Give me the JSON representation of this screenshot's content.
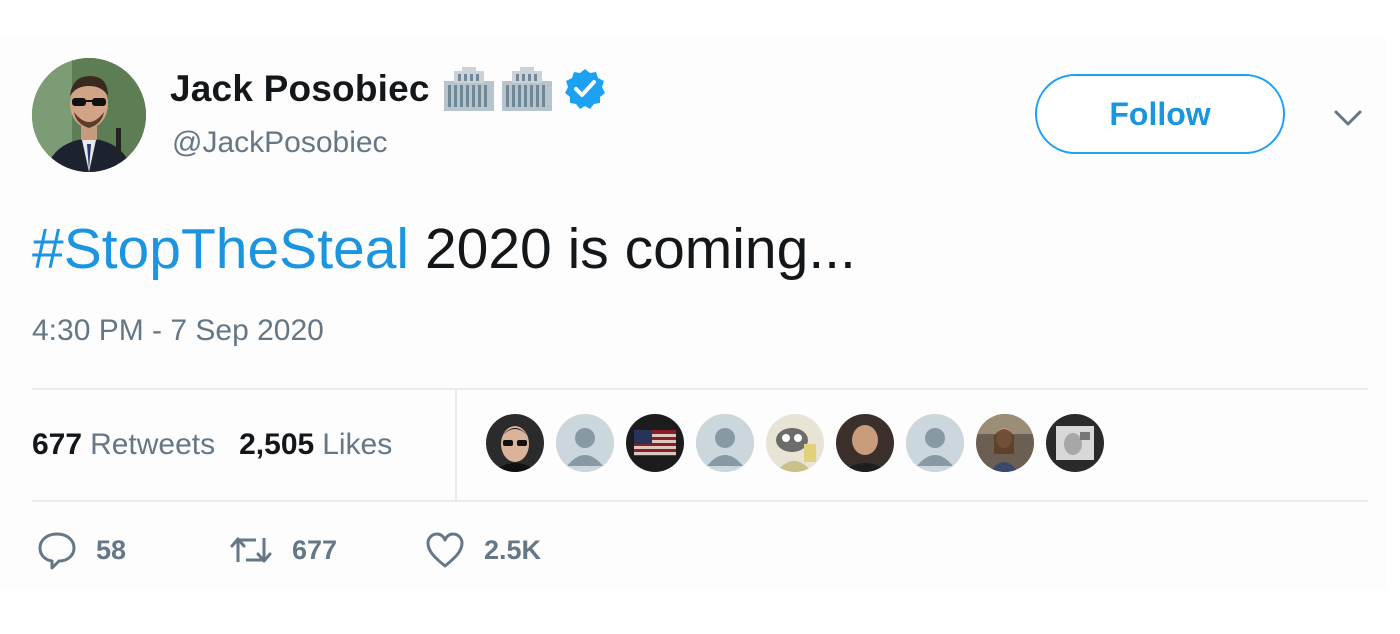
{
  "author": {
    "name": "Jack Posobiec",
    "handle": "@JackPosobiec",
    "name_emojis": [
      "hotel-building-icon",
      "hotel-building-icon"
    ],
    "verified": true
  },
  "follow_button": {
    "label": "Follow"
  },
  "tweet": {
    "hashtag": "#StopTheSteal",
    "text": " 2020 is coming...",
    "timestamp": "4:30 PM - 7 Sep 2020"
  },
  "stats": {
    "retweets_count": "677",
    "retweets_label": "Retweets",
    "likes_count": "2,505",
    "likes_label": "Likes"
  },
  "likers": [
    {
      "icon": "liker-avatar-sunglasses"
    },
    {
      "icon": "default-profile-icon"
    },
    {
      "icon": "liker-avatar-flag"
    },
    {
      "icon": "default-profile-icon"
    },
    {
      "icon": "liker-avatar-cartoon"
    },
    {
      "icon": "liker-avatar-man"
    },
    {
      "icon": "default-profile-icon"
    },
    {
      "icon": "liker-avatar-woman"
    },
    {
      "icon": "liker-avatar-photo"
    }
  ],
  "actions": {
    "replies": "58",
    "retweets": "677",
    "likes": "2.5K"
  },
  "colors": {
    "link_blue": "#1b95e0",
    "text_dark": "#14171a",
    "text_gray": "#657786",
    "divider": "#e6ecf0",
    "verified_blue": "#1da1f2"
  }
}
